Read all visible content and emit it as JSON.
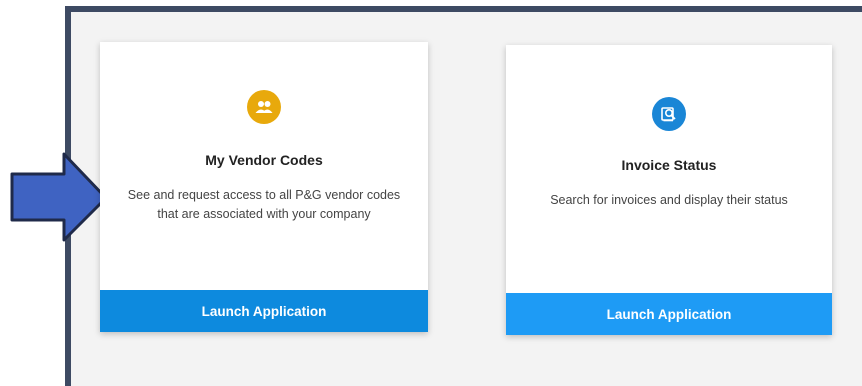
{
  "colors": {
    "frame_border": "#3d4a63",
    "vendor_icon_bg": "#e8a90c",
    "invoice_icon_bg": "#1a86d6",
    "launch_button": "#1e9bf5",
    "arrow_fill": "#3f63c2",
    "arrow_stroke": "#1f2a4a"
  },
  "cards": [
    {
      "icon": "people-icon",
      "title": "My Vendor Codes",
      "description": "See and request access to all P&G vendor codes that are associated with your company",
      "button_label": "Launch Application"
    },
    {
      "icon": "invoice-search-icon",
      "title": "Invoice Status",
      "description": "Search for invoices and display their status",
      "button_label": "Launch Application"
    }
  ],
  "annotation": {
    "icon": "arrow-right-icon"
  }
}
